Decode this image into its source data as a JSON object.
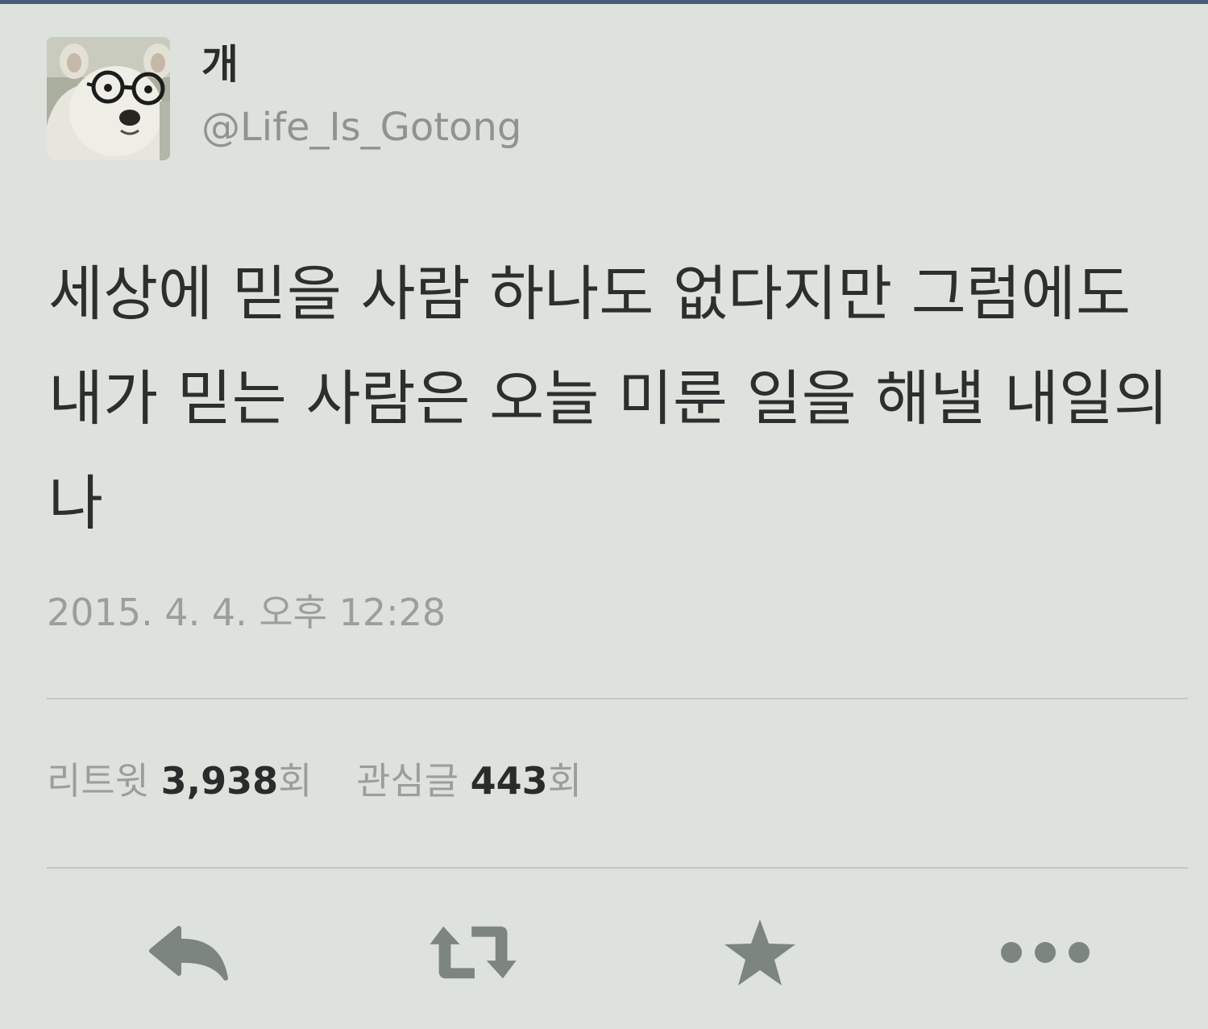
{
  "tweet": {
    "display_name": "개",
    "handle": "@Life_Is_Gotong",
    "text": "세상에 믿을 사람 하나도 없다지만 그럼에도 내가 믿는 사람은 오늘 미룬 일을 해낼 내일의 나",
    "timestamp": "2015. 4. 4. 오후 12:28"
  },
  "stats": {
    "retweets": {
      "label": "리트윗",
      "count": "3,938",
      "unit": "회"
    },
    "favorites": {
      "label": "관심글",
      "count": "443",
      "unit": "회"
    }
  },
  "actions": {
    "reply_icon": "reply-icon",
    "retweet_icon": "retweet-icon",
    "favorite_icon": "star-icon",
    "more_icon": "more-icon"
  },
  "colors": {
    "background": "#dde3dc",
    "text": "#2c2f2e",
    "secondary_text": "#9a9f9b",
    "icon": "#7c8580",
    "top_bar": "#4b5b7a"
  }
}
